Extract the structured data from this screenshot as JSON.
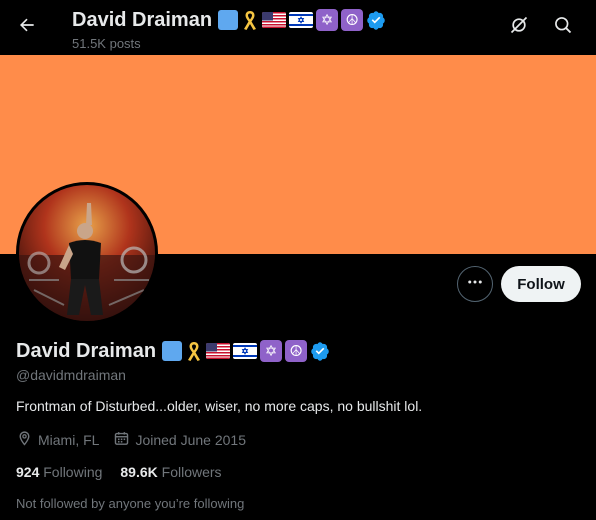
{
  "header": {
    "name": "David Draiman",
    "posts": "51.5K posts"
  },
  "colors": {
    "banner": "#ff8c4a",
    "verified": "#1d9bf0",
    "background": "#000000",
    "emoji_blue_square": "#5fa8ef",
    "emoji_purple": "#8f62c9",
    "ribbon": "#f5c542"
  },
  "name_emojis": [
    "blue-square",
    "yellow-ribbon",
    "us-flag",
    "israel-flag",
    "star-of-david",
    "peace-symbol"
  ],
  "emoji_glyphs": {
    "star_of_david": "✡",
    "peace": "☮"
  },
  "icons": [
    "back-arrow-icon",
    "grok-slash-icon",
    "search-icon",
    "more-dots-icon",
    "location-icon",
    "calendar-icon",
    "verified-badge-icon"
  ],
  "profile": {
    "name": "David Draiman",
    "handle": "@davidmdraiman",
    "bio": "Frontman of Disturbed...older, wiser, no more caps, no bullshit lol.",
    "location": "Miami, FL",
    "joined": "Joined June 2015",
    "following_count": "924",
    "following_label": "Following",
    "followers_count": "89.6K",
    "followers_label": "Followers",
    "not_followed": "Not followed by anyone you’re following"
  },
  "actions": {
    "follow_label": "Follow"
  }
}
